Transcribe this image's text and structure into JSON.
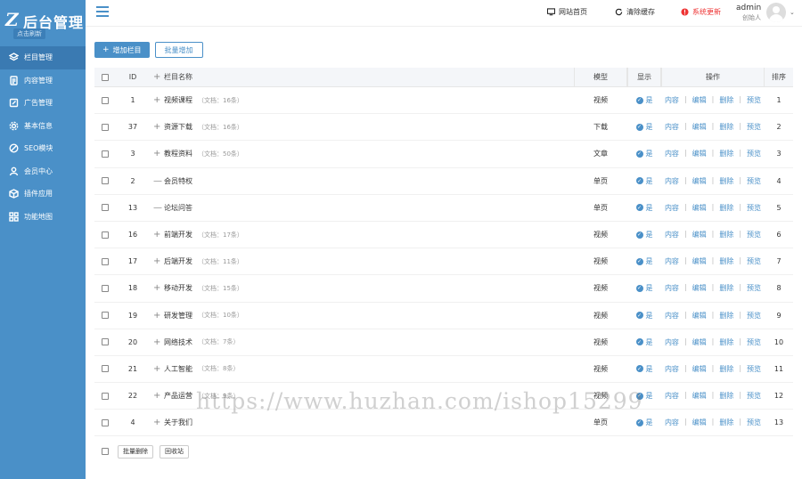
{
  "logo": {
    "mark": "Z",
    "title": "后台管理",
    "tag": "点击刷新"
  },
  "sidebar": {
    "items": [
      {
        "label": "栏目管理",
        "icon": "layers-icon",
        "active": true
      },
      {
        "label": "内容管理",
        "icon": "document-icon",
        "active": false
      },
      {
        "label": "广告管理",
        "icon": "edit-icon",
        "active": false
      },
      {
        "label": "基本信息",
        "icon": "gear-icon",
        "active": false
      },
      {
        "label": "SEO模块",
        "icon": "compass-icon",
        "active": false
      },
      {
        "label": "会员中心",
        "icon": "user-icon",
        "active": false
      },
      {
        "label": "插件应用",
        "icon": "package-icon",
        "active": false
      },
      {
        "label": "功能地图",
        "icon": "grid-icon",
        "active": false
      }
    ]
  },
  "header": {
    "links": [
      {
        "label": "网站首页",
        "icon": "monitor-icon"
      },
      {
        "label": "清除缓存",
        "icon": "refresh-icon"
      },
      {
        "label": "系统更新",
        "icon": "alert-icon"
      }
    ],
    "user": {
      "name": "admin",
      "role": "创始人"
    }
  },
  "toolbar": {
    "add_label": "增加栏目",
    "batch_add_label": "批量增加"
  },
  "table": {
    "headers": {
      "id": "ID",
      "name": "栏目名称",
      "model": "模型",
      "show": "显示",
      "ops": "操作",
      "sort": "排序"
    },
    "ops": [
      "内容",
      "编辑",
      "删除",
      "预览"
    ],
    "show_text": "是",
    "rows": [
      {
        "id": "1",
        "name": "视频课程",
        "count": "（文档：16条）",
        "model": "视频",
        "sort": "1",
        "expander": "+"
      },
      {
        "id": "37",
        "name": "资源下载",
        "count": "（文档：16条）",
        "model": "下载",
        "sort": "2",
        "expander": "+"
      },
      {
        "id": "3",
        "name": "教程资料",
        "count": "（文档：50条）",
        "model": "文章",
        "sort": "3",
        "expander": "+"
      },
      {
        "id": "2",
        "name": "会员特权",
        "count": "",
        "model": "单页",
        "sort": "4",
        "expander": "—"
      },
      {
        "id": "13",
        "name": "论坛问答",
        "count": "",
        "model": "单页",
        "sort": "5",
        "expander": "—"
      },
      {
        "id": "16",
        "name": "前端开发",
        "count": "（文档：17条）",
        "model": "视频",
        "sort": "6",
        "expander": "+"
      },
      {
        "id": "17",
        "name": "后端开发",
        "count": "（文档：11条）",
        "model": "视频",
        "sort": "7",
        "expander": "+"
      },
      {
        "id": "18",
        "name": "移动开发",
        "count": "（文档：15条）",
        "model": "视频",
        "sort": "8",
        "expander": "+"
      },
      {
        "id": "19",
        "name": "研发管理",
        "count": "（文档：10条）",
        "model": "视频",
        "sort": "9",
        "expander": "+"
      },
      {
        "id": "20",
        "name": "网络技术",
        "count": "（文档：7条）",
        "model": "视频",
        "sort": "10",
        "expander": "+"
      },
      {
        "id": "21",
        "name": "人工智能",
        "count": "（文档：8条）",
        "model": "视频",
        "sort": "11",
        "expander": "+"
      },
      {
        "id": "22",
        "name": "产品运营",
        "count": "（文档：9条）",
        "model": "视频",
        "sort": "12",
        "expander": "+"
      },
      {
        "id": "4",
        "name": "关于我们",
        "count": "",
        "model": "单页",
        "sort": "13",
        "expander": "+"
      }
    ]
  },
  "footer": {
    "batch_delete_label": "批量删除",
    "recycle_label": "回收站"
  },
  "watermark": "https://www.huzhan.com/ishop15299",
  "colors": {
    "accent": "#4a90c8",
    "alert": "#e33333"
  }
}
